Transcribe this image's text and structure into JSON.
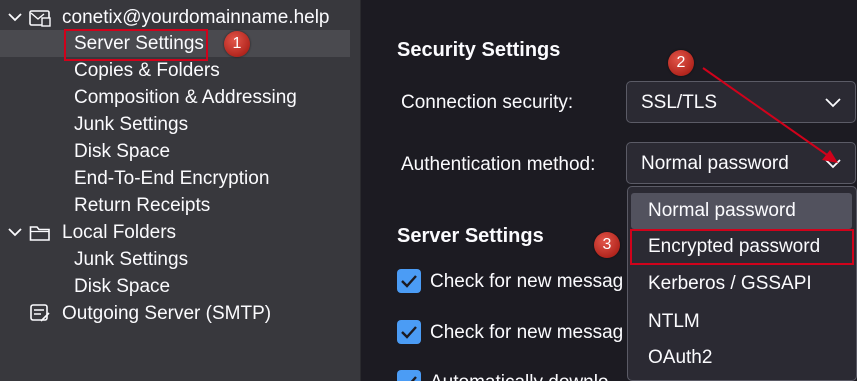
{
  "sidebar": {
    "account": "conetix@yourdomainname.help",
    "account_items": [
      "Server Settings",
      "Copies & Folders",
      "Composition & Addressing",
      "Junk Settings",
      "Disk Space",
      "End-To-End Encryption",
      "Return Receipts"
    ],
    "local_folders": "Local Folders",
    "local_items": [
      "Junk Settings",
      "Disk Space"
    ],
    "outgoing": "Outgoing Server (SMTP)"
  },
  "security": {
    "title": "Security Settings",
    "connection_label": "Connection security:",
    "connection_value": "SSL/TLS",
    "auth_label": "Authentication method:",
    "auth_value": "Normal password"
  },
  "server": {
    "title": "Server Settings",
    "check1": "Check for new messag",
    "check2": "Check for new messag",
    "check3": "Automatically downlo"
  },
  "dropdown": {
    "options": [
      "Normal password",
      "Encrypted password",
      "Kerberos / GSSAPI",
      "NTLM",
      "OAuth2"
    ],
    "highlighted": "Normal password"
  },
  "callouts": {
    "one": "1",
    "two": "2",
    "three": "3"
  },
  "colors": {
    "accent": "#4b9cf5",
    "callout": "#d0021b",
    "sidebar_bg": "#38383d",
    "main_bg": "#1c1b22"
  }
}
